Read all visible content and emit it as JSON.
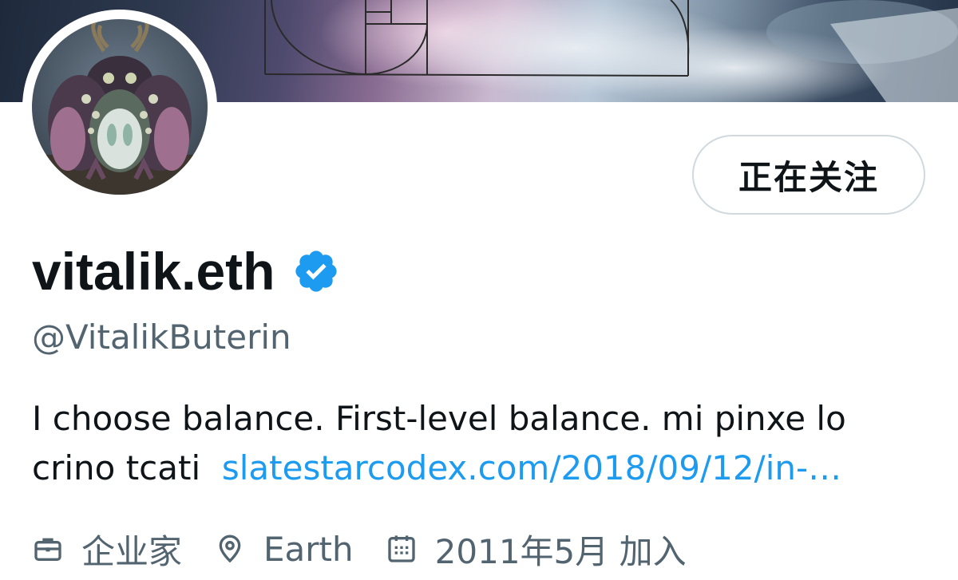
{
  "profile": {
    "display_name": "vitalik.eth",
    "handle": "@VitalikButerin",
    "follow_button_label": "正在关注",
    "bio_text_line1": "I choose balance. First-level balance.  mi pinxe lo",
    "bio_text_line2": "crino tcati",
    "bio_link": "slatestarcodex.com/2018/09/12/in-…",
    "profession": "企业家",
    "location": "Earth",
    "joined": "2011年5月 加入"
  },
  "icons": {
    "verified": "verified-badge-icon",
    "profession": "briefcase-icon",
    "location": "location-pin-icon",
    "joined": "calendar-icon"
  },
  "colors": {
    "link": "#1d9bf0",
    "verified": "#1d9bf0",
    "secondary_text": "#536471",
    "primary_text": "#0f1419",
    "button_border": "#cfd9de"
  }
}
